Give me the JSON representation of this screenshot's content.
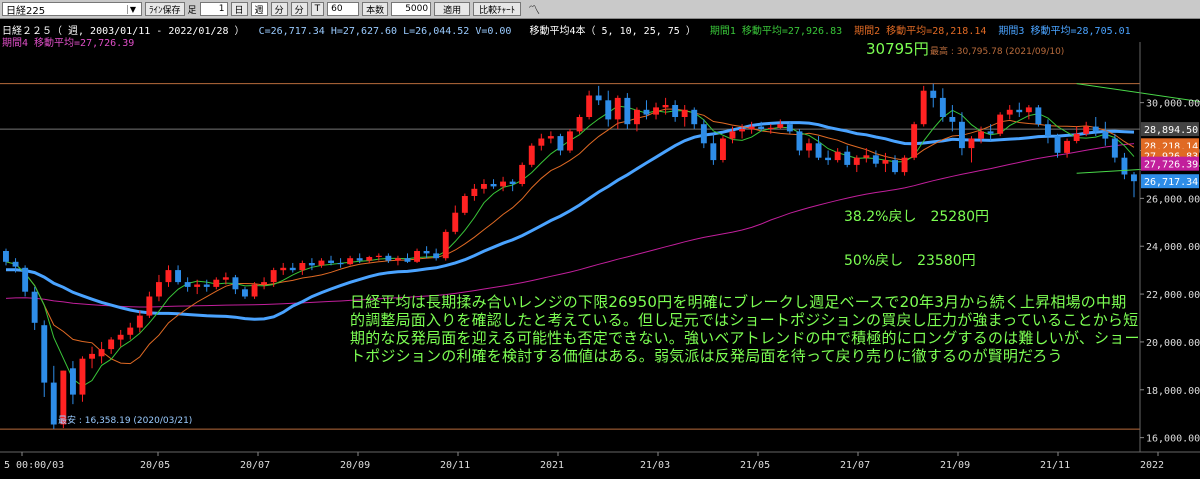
{
  "toolbar": {
    "symbol": "日経225",
    "save_label": "ﾗｲﾝ保存",
    "foot_label": "足",
    "period_count": "1",
    "tf_day": "日",
    "tf_week": "週",
    "tf_month": "分",
    "tf_quarter": "分",
    "tf_tick": "T",
    "fraction": "60",
    "bars_label": "本数",
    "bars_value": "5000",
    "apply_label": "適用",
    "compare_label": "比較ﾁｬｰﾄ"
  },
  "info": {
    "symbol_info": "日経２２５（ 週, 2003/01/11 - 2022/01/28 ）",
    "ohlc": "C=26,717.34 H=27,627.60 L=26,044.52 V=0.00",
    "ma_set": "移動平均4本（ 5, 10, 25, 75 ）",
    "ma1": "期間1 移動平均=27,926.83",
    "ma2": "期間2 移動平均=28,218.14",
    "ma3": "期間3 移動平均=28,705.01",
    "ma4": "期間4 移動平均=27,726.39"
  },
  "colors": {
    "up": "#ff2222",
    "down": "#2e8de8",
    "ma1": "#39c639",
    "ma2": "#e06a24",
    "ma3": "#4aa3ff",
    "ma4": "#c21f9c",
    "hline": "#b86b3c",
    "annotation": "#7dff53"
  },
  "annotations": {
    "high_label": "30795円",
    "high_note": "最高 : 30,795.78 (2021/09/10)",
    "low_note": "最安 : 16,358.19 (2020/03/21)",
    "fib38": "38.2%戻し　25280円",
    "fib50": "50%戻し　23580円",
    "commentary": "日経平均は長期揉み合いレンジの下限26950円を明確にブレークし週足ベースで20年3月から続く上昇相場の中期的調整局面入りを確認したと考えている。但し足元ではショートポジションの買戻し圧力が強まっていることから短期的な反発局面を迎える可能性も否定できない。強いベアトレンドの中で積極的にロングするのは難しいが、ショートポジションの利確を検討する価値はある。弱気派は反発局面を待って戻り売りに徹するのが賢明だろう"
  },
  "chart_data": {
    "type": "candlestick",
    "ylim": [
      15400,
      32200
    ],
    "y_ticks": [
      "30,000.00",
      "28,000.00",
      "26,000.00",
      "24,000.00",
      "22,000.00",
      "20,000.00",
      "18,000.00",
      "16,000.00"
    ],
    "y_tick_values": [
      30000,
      28000,
      26000,
      24000,
      22000,
      20000,
      18000,
      16000
    ],
    "x_labels": [
      "5 00:00/03",
      "20/05",
      "20/07",
      "20/09",
      "20/11",
      "2021",
      "21/03",
      "21/05",
      "21/07",
      "21/09",
      "21/11",
      "2022"
    ],
    "price_tags": [
      {
        "text": "28,894.50",
        "value": 28894.5,
        "color": "#444444"
      },
      {
        "text": "28,218.14",
        "value": 28218,
        "color": "#e06a24"
      },
      {
        "text": "27,926.83",
        "value": 27800,
        "color": "#e06a24"
      },
      {
        "text": "27,726.39",
        "value": 27450,
        "color": "#c21f9c"
      },
      {
        "text": "26,717.34",
        "value": 26717,
        "color": "#2e8de8"
      }
    ],
    "hlines": [
      30795,
      28894.5,
      16358
    ],
    "triangle": {
      "upper": [
        [
          112,
          30795
        ],
        [
          148,
          28700
        ]
      ],
      "lower": [
        [
          112,
          27050
        ],
        [
          148,
          27900
        ]
      ]
    },
    "candles": [
      [
        23800,
        23900,
        23200,
        23350
      ],
      [
        23350,
        23500,
        22900,
        23150
      ],
      [
        23100,
        23200,
        21900,
        22100
      ],
      [
        22100,
        22300,
        20500,
        20800
      ],
      [
        20700,
        20900,
        17700,
        18300
      ],
      [
        18300,
        19000,
        16358,
        16550
      ],
      [
        16550,
        18800,
        16400,
        18800
      ],
      [
        18900,
        19200,
        17400,
        17800
      ],
      [
        17800,
        19400,
        17500,
        19300
      ],
      [
        19300,
        19800,
        18900,
        19500
      ],
      [
        19400,
        20000,
        19100,
        19700
      ],
      [
        19700,
        20200,
        19500,
        20100
      ],
      [
        20100,
        20500,
        19800,
        20300
      ],
      [
        20300,
        20800,
        20100,
        20600
      ],
      [
        20600,
        21300,
        20400,
        21100
      ],
      [
        21100,
        22100,
        21000,
        21900
      ],
      [
        21900,
        22800,
        21700,
        22500
      ],
      [
        22500,
        23200,
        22300,
        23000
      ],
      [
        23000,
        23200,
        22400,
        22500
      ],
      [
        22500,
        22700,
        22100,
        22300
      ],
      [
        22300,
        22600,
        22000,
        22400
      ],
      [
        22400,
        22600,
        22100,
        22300
      ],
      [
        22300,
        22700,
        22200,
        22600
      ],
      [
        22600,
        22900,
        22400,
        22700
      ],
      [
        22700,
        22800,
        22000,
        22200
      ],
      [
        22200,
        22300,
        21800,
        21900
      ],
      [
        21900,
        22500,
        21800,
        22400
      ],
      [
        22400,
        22700,
        22200,
        22500
      ],
      [
        22500,
        23100,
        22300,
        23000
      ],
      [
        23000,
        23300,
        22800,
        23100
      ],
      [
        23100,
        23300,
        22900,
        23000
      ],
      [
        23000,
        23400,
        22800,
        23300
      ],
      [
        23300,
        23500,
        23000,
        23200
      ],
      [
        23200,
        23500,
        23100,
        23400
      ],
      [
        23400,
        23600,
        23200,
        23300
      ],
      [
        23300,
        23500,
        23100,
        23250
      ],
      [
        23250,
        23600,
        23200,
        23500
      ],
      [
        23500,
        23700,
        23300,
        23400
      ],
      [
        23400,
        23600,
        23300,
        23550
      ],
      [
        23550,
        23700,
        23400,
        23600
      ],
      [
        23600,
        23700,
        23300,
        23400
      ],
      [
        23400,
        23600,
        23200,
        23500
      ],
      [
        23500,
        23700,
        23300,
        23350
      ],
      [
        23350,
        23900,
        23300,
        23800
      ],
      [
        23800,
        24000,
        23500,
        23700
      ],
      [
        23700,
        23900,
        23400,
        23500
      ],
      [
        23500,
        24700,
        23400,
        24600
      ],
      [
        24600,
        25700,
        24500,
        25400
      ],
      [
        25400,
        26200,
        25300,
        26100
      ],
      [
        26100,
        26600,
        25900,
        26400
      ],
      [
        26400,
        26800,
        26200,
        26600
      ],
      [
        26600,
        26800,
        26400,
        26500
      ],
      [
        26500,
        26900,
        26300,
        26700
      ],
      [
        26700,
        26800,
        26300,
        26600
      ],
      [
        26600,
        27500,
        26500,
        27400
      ],
      [
        27400,
        28300,
        27300,
        28200
      ],
      [
        28200,
        28700,
        28000,
        28500
      ],
      [
        28500,
        28800,
        28300,
        28600
      ],
      [
        28600,
        28700,
        27800,
        28000
      ],
      [
        28000,
        28900,
        27900,
        28800
      ],
      [
        28800,
        29500,
        28700,
        29400
      ],
      [
        29400,
        30500,
        29300,
        30300
      ],
      [
        30300,
        30700,
        29900,
        30100
      ],
      [
        30100,
        30500,
        29000,
        29300
      ],
      [
        29300,
        30300,
        28900,
        30200
      ],
      [
        30200,
        30400,
        28900,
        29100
      ],
      [
        29100,
        29800,
        28800,
        29700
      ],
      [
        29700,
        30100,
        29300,
        29500
      ],
      [
        29500,
        30000,
        29300,
        29800
      ],
      [
        29800,
        30200,
        29500,
        29900
      ],
      [
        29900,
        30100,
        29200,
        29400
      ],
      [
        29400,
        29900,
        29000,
        29700
      ],
      [
        29700,
        29800,
        28900,
        29100
      ],
      [
        29100,
        29300,
        28100,
        28300
      ],
      [
        28300,
        28700,
        27400,
        27600
      ],
      [
        27600,
        28600,
        27500,
        28500
      ],
      [
        28500,
        29000,
        28300,
        28800
      ],
      [
        28800,
        29100,
        28500,
        28900
      ],
      [
        28900,
        29200,
        28700,
        29000
      ],
      [
        29000,
        29200,
        28800,
        28900
      ],
      [
        28900,
        29100,
        28700,
        28950
      ],
      [
        28950,
        29300,
        28900,
        29100
      ],
      [
        29100,
        29200,
        28700,
        28800
      ],
      [
        28800,
        28900,
        27800,
        28000
      ],
      [
        28000,
        28500,
        27700,
        28300
      ],
      [
        28300,
        28600,
        27600,
        27700
      ],
      [
        27700,
        28000,
        27400,
        27600
      ],
      [
        27600,
        28100,
        27500,
        27950
      ],
      [
        27950,
        28200,
        27300,
        27400
      ],
      [
        27400,
        27800,
        27100,
        27700
      ],
      [
        27700,
        28100,
        27500,
        27800
      ],
      [
        27800,
        28000,
        27300,
        27450
      ],
      [
        27450,
        27900,
        27100,
        27600
      ],
      [
        27600,
        27800,
        27000,
        27100
      ],
      [
        27100,
        27800,
        26950,
        27700
      ],
      [
        27700,
        29200,
        27600,
        29100
      ],
      [
        29100,
        30700,
        29000,
        30500
      ],
      [
        30500,
        30795,
        29800,
        30200
      ],
      [
        30200,
        30600,
        29200,
        29400
      ],
      [
        29400,
        29900,
        28800,
        29200
      ],
      [
        29200,
        29600,
        27800,
        28100
      ],
      [
        28100,
        28600,
        27500,
        28500
      ],
      [
        28500,
        29000,
        28300,
        28800
      ],
      [
        28800,
        29100,
        28400,
        28700
      ],
      [
        28700,
        29600,
        28600,
        29500
      ],
      [
        29500,
        29900,
        29300,
        29700
      ],
      [
        29700,
        30000,
        29400,
        29600
      ],
      [
        29600,
        29900,
        29300,
        29800
      ],
      [
        29800,
        29900,
        29000,
        29100
      ],
      [
        29100,
        29300,
        28300,
        28600
      ],
      [
        28600,
        28700,
        27700,
        27900
      ],
      [
        27900,
        28500,
        27700,
        28400
      ],
      [
        28400,
        29000,
        28300,
        28700
      ],
      [
        28700,
        29200,
        28600,
        29000
      ],
      [
        29000,
        29400,
        28600,
        28800
      ],
      [
        28800,
        29200,
        28200,
        28500
      ],
      [
        28500,
        28700,
        27500,
        27700
      ],
      [
        27700,
        27900,
        26800,
        27000
      ],
      [
        27000,
        27100,
        26044,
        26717
      ]
    ]
  }
}
